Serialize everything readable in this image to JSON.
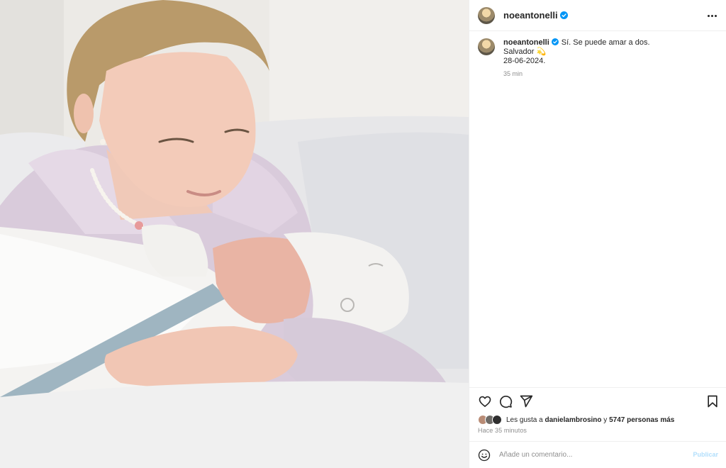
{
  "post": {
    "author": "noeantonelli",
    "verified": true,
    "caption_lines": [
      "Sí. Se puede amar a dos.",
      "Salvador 💫",
      "28-06-2024."
    ],
    "caption_age": "35 min",
    "likes": {
      "prefix": "Les gusta a",
      "first_liker": "danielambrosino",
      "connector": "y",
      "others": "5747 personas más"
    },
    "posted_ago": "Hace 35 minutos"
  },
  "icons": {
    "like": "heart-icon",
    "comment": "comment-icon",
    "share": "send-icon",
    "save": "bookmark-icon",
    "emoji": "emoji-icon",
    "more": "more-options-icon",
    "verified": "verified-badge-icon"
  },
  "comment": {
    "placeholder": "Añade un comentario...",
    "publish_label": "Publicar"
  },
  "colors": {
    "verified_blue": "#0095f6",
    "publish_disabled": "#b2dffc",
    "text_secondary": "#8e8e8e"
  }
}
